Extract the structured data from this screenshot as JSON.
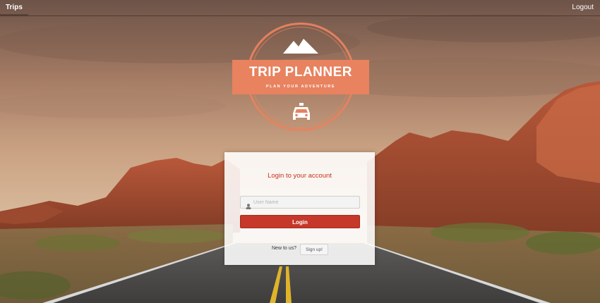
{
  "nav": {
    "trips_label": "Trips",
    "logout_label": "Logout"
  },
  "logo": {
    "title": "TRIP PLANNER",
    "subtitle": "PLAN YOUR ADVENTURE",
    "top_icon": "mountain-icon",
    "bottom_icon": "taxi-icon",
    "accent_color": "#e8825f"
  },
  "login": {
    "heading": "Login to your account",
    "username_placeholder": "User Name",
    "username_value": "",
    "login_button": "Login",
    "signup_prompt": "New to us?",
    "signup_button": "Sign up!",
    "heading_color": "#c9301f",
    "button_color": "#c5382a"
  }
}
